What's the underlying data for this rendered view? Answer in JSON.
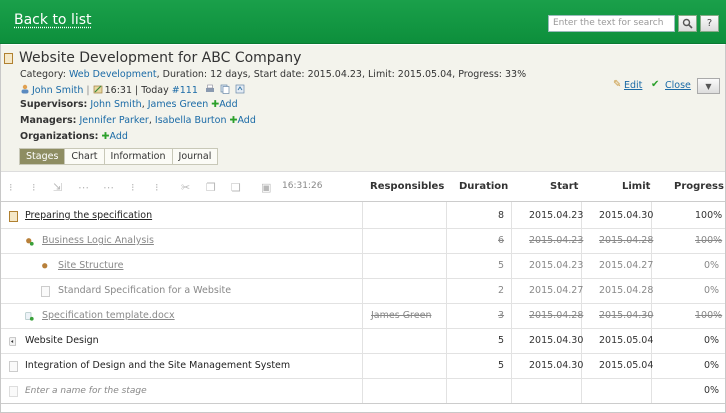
{
  "nav": {
    "back_label": "Back to list",
    "search_placeholder": "Enter the text for search",
    "search_icon": "magnifier-icon",
    "help_label": "?"
  },
  "task": {
    "title": "Website Development for ABC Company",
    "meta_category_label": "Category:",
    "meta_category": "Web Development",
    "meta_rest": ", Duration: 12 days, Start date: 2015.04.23, Limit: 2015.05.04, Progress: 33%",
    "owner": "John Smith",
    "time": "16:31",
    "today": "| Today",
    "task_number": "#111",
    "supervisors_label": "Supervisors:",
    "supervisors": [
      "John Smith",
      "James Green"
    ],
    "managers_label": "Managers:",
    "managers": [
      "Jennifer Parker",
      "Isabella Burton"
    ],
    "organizations_label": "Organizations:",
    "add_label": "Add",
    "edit_label": "Edit",
    "close_label": "Close"
  },
  "tabs": [
    "Stages",
    "Chart",
    "Information",
    "Journal"
  ],
  "toolbar": {
    "time": "16:31:26"
  },
  "columns": {
    "responsibles": "Responsibles",
    "duration": "Duration",
    "start": "Start",
    "limit": "Limit",
    "progress": "Progress"
  },
  "rows": [
    {
      "name": "Preparing the specification",
      "responsible": "",
      "duration": "8",
      "start": "2015.04.23",
      "limit": "2015.04.30",
      "progress": "100%"
    },
    {
      "name": "Business Logic Analysis",
      "responsible": "",
      "duration": "6",
      "start": "2015.04.23",
      "limit": "2015.04.28",
      "progress": "100%"
    },
    {
      "name": "Site Structure",
      "responsible": "",
      "duration": "5",
      "start": "2015.04.23",
      "limit": "2015.04.27",
      "progress": "0%"
    },
    {
      "name": "Standard Specification for a Website",
      "responsible": "",
      "duration": "2",
      "start": "2015.04.27",
      "limit": "2015.04.28",
      "progress": "0%"
    },
    {
      "name": "Specification template.docx",
      "responsible": "James Green",
      "duration": "3",
      "start": "2015.04.28",
      "limit": "2015.04.30",
      "progress": "100%"
    },
    {
      "name": "Website Design",
      "responsible": "",
      "duration": "5",
      "start": "2015.04.30",
      "limit": "2015.05.04",
      "progress": "0%"
    },
    {
      "name": "Integration of Design and the Site Management System",
      "responsible": "",
      "duration": "5",
      "start": "2015.04.30",
      "limit": "2015.05.04",
      "progress": "0%"
    }
  ],
  "new_stage_placeholder": "Enter a name for the stage",
  "new_stage_progress": "0%",
  "colors": {
    "green_bar": "#0d8f3c",
    "link": "#1a6aa6",
    "tab_active": "#8e8d62"
  }
}
